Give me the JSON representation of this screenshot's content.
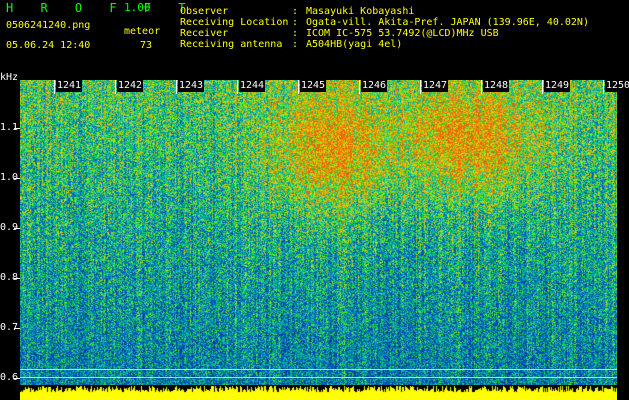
{
  "header": {
    "app_name": "H R O F F T",
    "version": "1.00",
    "filename": "0506241240.png",
    "datetime": "05.06.24 12:40",
    "meteor_label": "meteor",
    "meteor_count": "73"
  },
  "info": [
    {
      "label": "Observer",
      "value": "Masayuki Kobayashi"
    },
    {
      "label": "Receiving Location",
      "value": "Ogata-vill. Akita-Pref. JAPAN (139.96E, 40.02N)"
    },
    {
      "label": "Receiver",
      "value": "ICOM IC-575 53.7492(@LCD)MHz USB"
    },
    {
      "label": "Receiving antenna",
      "value": "A504HB(yagi 4el)"
    }
  ],
  "info_colon": ":",
  "axis": {
    "y_unit": "kHz",
    "y_ticks": [
      "1.1",
      "1.0",
      "0.9",
      "0.8",
      "0.7",
      "0.6"
    ],
    "x_ticks": [
      "1241",
      "1242",
      "1243",
      "1244",
      "1245",
      "1246",
      "1247",
      "1248",
      "1249",
      "1250"
    ]
  },
  "colors": {
    "title_green": "#00ff00",
    "label_yellow": "#ffff00",
    "bottom_bar": "#ffff00"
  }
}
